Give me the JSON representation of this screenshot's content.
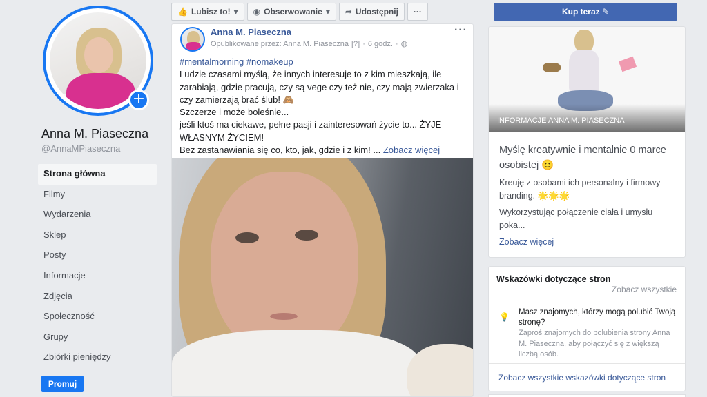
{
  "page": {
    "name": "Anna M. Piaseczna",
    "handle": "@AnnaMPiaseczna"
  },
  "nav": {
    "items": [
      {
        "label": "Strona główna",
        "active": true
      },
      {
        "label": "Filmy"
      },
      {
        "label": "Wydarzenia"
      },
      {
        "label": "Sklep"
      },
      {
        "label": "Posty"
      },
      {
        "label": "Informacje"
      },
      {
        "label": "Zdjęcia"
      },
      {
        "label": "Społeczność"
      },
      {
        "label": "Grupy"
      },
      {
        "label": "Zbiórki pieniędzy"
      }
    ],
    "promote_label": "Promuj"
  },
  "actions": {
    "like_label": "Lubisz to!",
    "follow_label": "Obserwowanie",
    "share_label": "Udostępnij",
    "more_label": "···",
    "buy_label": "Kup teraz"
  },
  "post": {
    "author": "Anna M. Piaseczna",
    "published_by": "Opublikowane przez: Anna M. Piaseczna",
    "help_marker": "[?]",
    "time": "6 godz.",
    "hashtags": "#mentalmorning #nomakeup",
    "line1": "Ludzie czasami myślą, że innych interesuje to z kim mieszkają, ile zarabiają, gdzie pracują, czy są vege czy też nie, czy mają zwierzaka i czy zamierzają brać ślub! 🙈",
    "line2": "Szczerze i może boleśnie...",
    "line3": "jeśli ktoś ma ciekawe, pełne pasji i zainteresowań życie to... ŻYJE WŁASNYM ŻYCIEM!",
    "line4": "Bez zastanawiania się co, kto, jak, gdzie i z kim! ...",
    "see_more": "Zobacz więcej"
  },
  "info": {
    "cover_caption": "INFORMACJE ANNA M. PIASECZNA",
    "lead": "Myślę kreatywnie i mentalnie 0 marce osobistej 🙂",
    "p1": "Kreuję z osobami ich personalny i firmowy branding. 🌟🌟🌟",
    "p2": "Wykorzystując połączenie ciała i umysłu poka...",
    "see_more": "Zobacz więcej"
  },
  "tips": {
    "title": "Wskazówki dotyczące stron",
    "see_all": "Zobacz wszystkie",
    "question": "Masz znajomych, którzy mogą polubić Twoją stronę?",
    "description": "Zaproś znajomych do polubienia strony Anna M. Piaseczna, aby połączyć się z większą liczbą osób.",
    "link": "Zobacz wszystkie wskazówki dotyczące stron"
  },
  "colors": {
    "accent": "#1877f2",
    "link": "#385898",
    "buy_button": "#4267b2",
    "background": "#e9ebee"
  }
}
